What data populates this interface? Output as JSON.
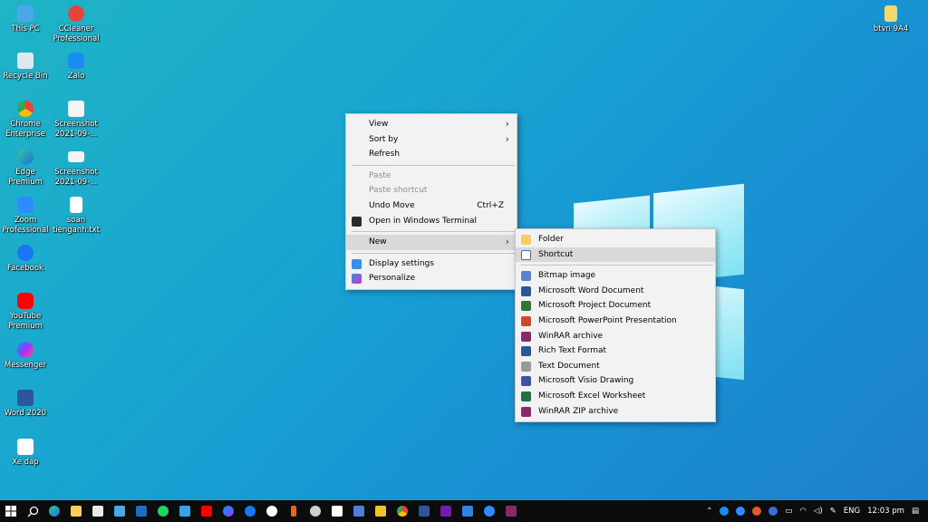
{
  "desktop": {
    "icons": [
      {
        "label": "This PC"
      },
      {
        "label": "CCleaner\nProfessional"
      },
      {
        "label": "Recycle Bin"
      },
      {
        "label": "Zalo"
      },
      {
        "label": "Chrome\nEnterprise"
      },
      {
        "label": "Screenshot\n2021-09-..."
      },
      {
        "label": "Edge\nPremium"
      },
      {
        "label": "Screenshot\n2021-09-..."
      },
      {
        "label": "Zoom\nProfessional"
      },
      {
        "label": "soan\ntienganh.txt"
      },
      {
        "label": "Facebook"
      },
      {
        "label": "YouTube\nPremium"
      },
      {
        "label": "Messenger"
      },
      {
        "label": "Word 2020"
      },
      {
        "label": "Xe dap"
      },
      {
        "label": "btvn 9A4"
      }
    ]
  },
  "context_menu": {
    "view": "View",
    "sort_by": "Sort by",
    "refresh": "Refresh",
    "paste": "Paste",
    "paste_shortcut": "Paste shortcut",
    "undo_move": "Undo Move",
    "undo_shortcut": "Ctrl+Z",
    "open_terminal": "Open in Windows Terminal",
    "new": "New",
    "display_settings": "Display settings",
    "personalize": "Personalize"
  },
  "new_submenu": {
    "folder": "Folder",
    "shortcut": "Shortcut",
    "items": [
      {
        "label": "Bitmap image",
        "color": "#5a7fd6"
      },
      {
        "label": "Microsoft Word Document",
        "color": "#2b579a"
      },
      {
        "label": "Microsoft Project Document",
        "color": "#31752f"
      },
      {
        "label": "Microsoft PowerPoint Presentation",
        "color": "#d24726"
      },
      {
        "label": "WinRAR archive",
        "color": "#8b2a6b"
      },
      {
        "label": "Rich Text Format",
        "color": "#2b579a"
      },
      {
        "label": "Text Document",
        "color": "#9a9a9a"
      },
      {
        "label": "Microsoft Visio Drawing",
        "color": "#3955a3"
      },
      {
        "label": "Microsoft Excel Worksheet",
        "color": "#217346"
      },
      {
        "label": "WinRAR ZIP archive",
        "color": "#8b2a6b"
      }
    ]
  },
  "taskbar": {
    "language": "ENG",
    "time": "12:03 pm"
  }
}
